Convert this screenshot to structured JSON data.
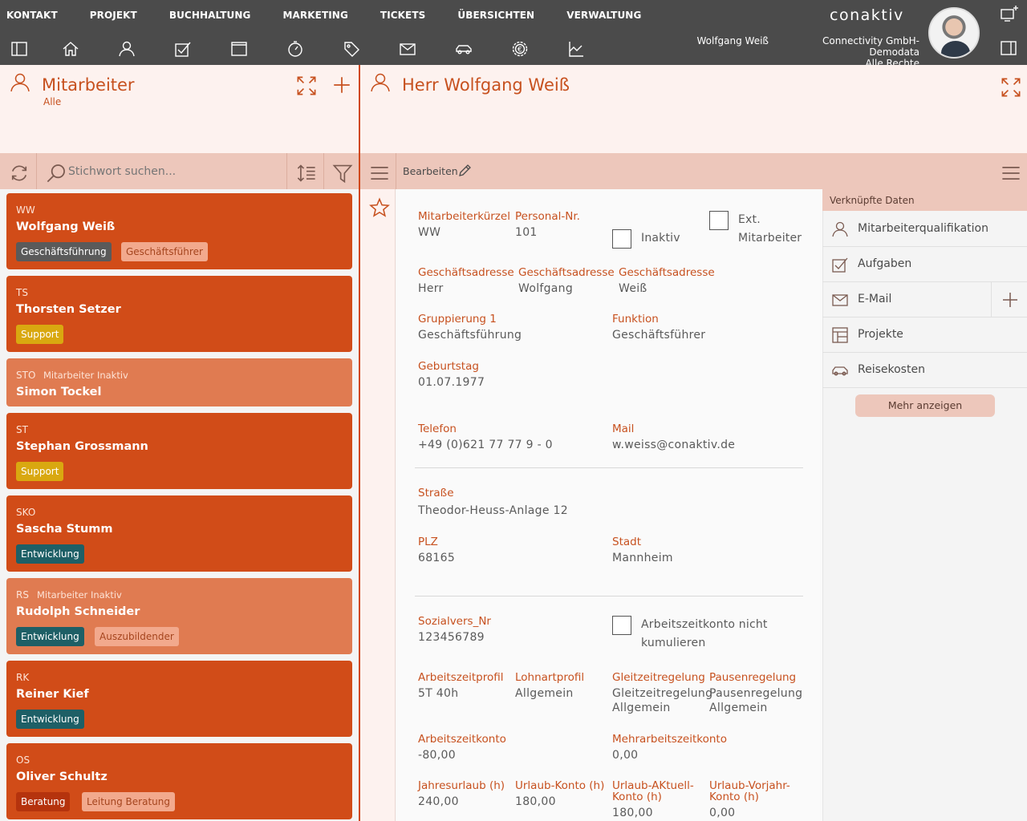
{
  "menu": [
    "KONTAKT",
    "PROJEKT",
    "BUCHHALTUNG",
    "MARKETING",
    "TICKETS",
    "ÜBERSICHTEN",
    "VERWALTUNG"
  ],
  "logo": "conaktiv",
  "user": {
    "name": "Wolfgang Weiß",
    "company": "Connectivity GmbH-Demodata",
    "rights": "Alle Rechte"
  },
  "left": {
    "title": "Mitarbeiter",
    "subtitle": "Alle",
    "search_placeholder": "Stichwort suchen...",
    "employees": [
      {
        "abbr": "WW",
        "inactive": "",
        "name": "Wolfgang Weiß",
        "tags": [
          "Geschäftsführung",
          "Geschäftsführer"
        ]
      },
      {
        "abbr": "TS",
        "inactive": "",
        "name": "Thorsten Setzer",
        "tags": [
          "Support"
        ]
      },
      {
        "abbr": "STO",
        "inactive": "Mitarbeiter Inaktiv",
        "name": "Simon Tockel",
        "tags": []
      },
      {
        "abbr": "ST",
        "inactive": "",
        "name": "Stephan Grossmann",
        "tags": [
          "Support"
        ]
      },
      {
        "abbr": "SKO",
        "inactive": "",
        "name": "Sascha Stumm",
        "tags": [
          "Entwicklung"
        ]
      },
      {
        "abbr": "RS",
        "inactive": "Mitarbeiter Inaktiv",
        "name": "Rudolph Schneider",
        "tags": [
          "Entwicklung",
          "Auszubildender"
        ]
      },
      {
        "abbr": "RK",
        "inactive": "",
        "name": "Reiner Kief",
        "tags": [
          "Entwicklung"
        ]
      },
      {
        "abbr": "OS",
        "inactive": "",
        "name": "Oliver Schultz",
        "tags": [
          "Beratung",
          "Leitung Beratung"
        ]
      }
    ]
  },
  "detail": {
    "title": "Herr Wolfgang Weiß",
    "edit_label": "Bearbeiten",
    "fields": {
      "kuerzel_label": "Mitarbeiterkürzel",
      "kuerzel": "WW",
      "personalnr_label": "Personal-Nr.",
      "personalnr": "101",
      "inaktiv_label": "Inaktiv",
      "ext_label": "Ext.",
      "ext_label2": "Mitarbeiter",
      "ga1_label": "Geschäftsadresse",
      "ga1": "Herr",
      "ga2_label": "Geschäftsadresse",
      "ga2": "Wolfgang",
      "ga3_label": "Geschäftsadresse",
      "ga3": "Weiß",
      "gruppierung_label": "Gruppierung 1",
      "gruppierung": "Geschäftsführung",
      "funktion_label": "Funktion",
      "funktion": "Geschäftsführer",
      "geburtstag_label": "Geburtstag",
      "geburtstag": "01.07.1977",
      "telefon_label": "Telefon",
      "telefon": "+49 (0)621 77 77 9 - 0",
      "mail_label": "Mail",
      "mail": "w.weiss@conaktiv.de",
      "strasse_label": "Straße",
      "strasse": "Theodor-Heuss-Anlage 12",
      "plz_label": "PLZ",
      "plz": "68165",
      "stadt_label": "Stadt",
      "stadt": "Mannheim",
      "sv_label": "Sozialvers_Nr",
      "sv": "123456789",
      "azk_chk_label1": "Arbeitszeitkonto nicht",
      "azk_chk_label2": "kumulieren",
      "azp_label": "Arbeitszeitprofil",
      "azp": "5T 40h",
      "lohn_label": "Lohnartprofil",
      "lohn": "Allgemein",
      "gleit_label": "Gleitzeitregelung",
      "gleit1": "Gleitzeitregelung",
      "gleit2": "Allgemein",
      "pause_label": "Pausenregelung",
      "pause1": "Pausenregelung",
      "pause2": "Allgemein",
      "azk_label": "Arbeitszeitkonto",
      "azk": "-80,00",
      "mehr_label": "Mehrarbeitszeitkonto",
      "mehr": "0,00",
      "jahres_label": "Jahresurlaub (h)",
      "jahres": "240,00",
      "ukonto_label": "Urlaub-Konto (h)",
      "ukonto": "180,00",
      "uaktuell_label1": "Urlaub-AKtuell-",
      "uaktuell_label2": "Konto (h)",
      "uaktuell": "180,00",
      "uvorjahr_label1": "Urlaub-Vorjahr-",
      "uvorjahr_label2": "Konto (h)",
      "uvorjahr": "0,00"
    }
  },
  "linked": {
    "header": "Verknüpfte Daten",
    "items": [
      "Mitarbeiterqualifikation",
      "Aufgaben",
      "E-Mail",
      "Projekte",
      "Reisekosten"
    ],
    "more": "Mehr anzeigen"
  },
  "colors": {
    "accent": "#d14c18",
    "accent_light": "#e07b51",
    "topbar": "#4b4b4b",
    "toolbar": "#edc7bb",
    "label": "#c7511f"
  }
}
